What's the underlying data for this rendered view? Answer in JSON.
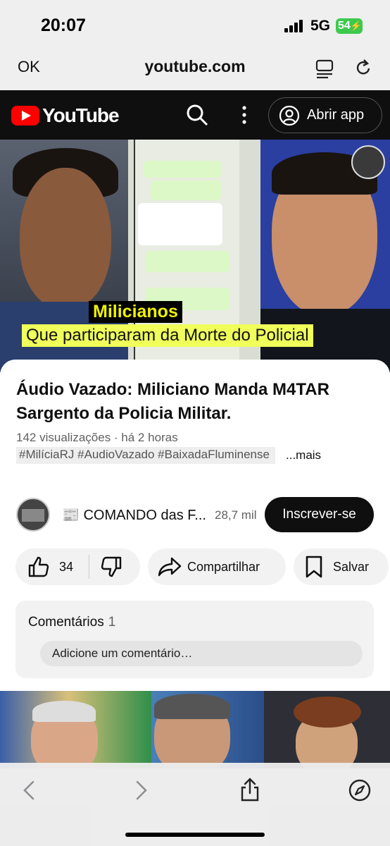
{
  "status_bar": {
    "time": "20:07",
    "network": "5G",
    "battery": "54",
    "battery_color": "#3ec94d"
  },
  "browser": {
    "done_label": "OK",
    "url": "youtube.com",
    "reader_icon": "reader-mode-icon",
    "reload_icon": "reload-icon"
  },
  "youtube_header": {
    "logo_text": "YouTube",
    "brand_color": "#ff0000",
    "open_app_label": "Abrir app"
  },
  "video": {
    "caption_line1": "Milicianos",
    "caption_line2": "Que participaram da Morte do Policial"
  },
  "details": {
    "title": "Áudio Vazado: Miliciano Manda M4TAR Sargento da Policia Militar.",
    "views_time": "142 visualizações · há 2 horas",
    "hashtags": "#MilíciaRJ #AudioVazado #BaixadaFluminense",
    "more_label": "...mais"
  },
  "channel": {
    "name": "📰 COMANDO das F...",
    "subscribers": "28,7 mil",
    "subscribe_label": "Inscrever-se"
  },
  "actions": {
    "likes": "34",
    "share_label": "Compartilhar",
    "save_label": "Salvar"
  },
  "comments": {
    "title": "Comentários",
    "count": "1",
    "placeholder": "Adicione um comentário…"
  }
}
